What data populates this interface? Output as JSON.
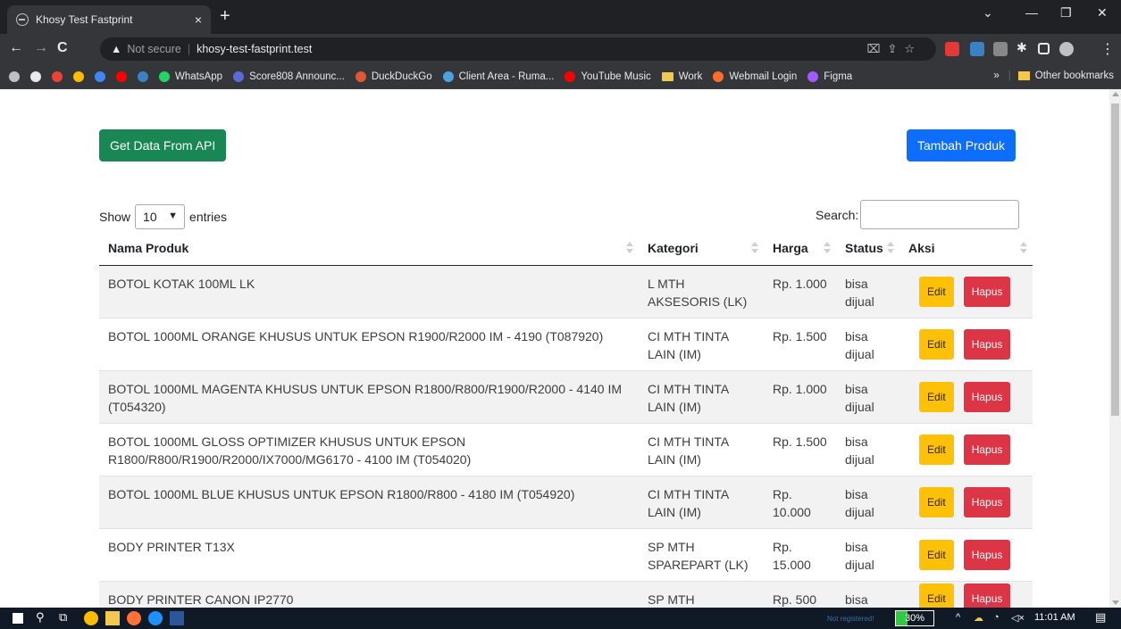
{
  "browser": {
    "tab_title": "Khosy Test Fastprint",
    "tab_close": "×",
    "new_tab": "+",
    "not_secure": "Not secure",
    "url": "khosy-test-fastprint.test",
    "bookmarks": [
      {
        "label": "WhatsApp",
        "color": "#25d366"
      },
      {
        "label": "Score808 Announc...",
        "color": "#5b6bd6"
      },
      {
        "label": "DuckDuckGo",
        "color": "#de5833"
      },
      {
        "label": "Client Area - Ruma...",
        "color": "#4aa3df"
      },
      {
        "label": "YouTube Music",
        "color": "#ff0000"
      },
      {
        "label": "Work",
        "color": "#f2c94c",
        "folder": true
      },
      {
        "label": "Webmail Login",
        "color": "#ff6c2c"
      },
      {
        "label": "Figma",
        "color": "#a259ff"
      }
    ],
    "overflow": "»",
    "other_bookmarks": "Other bookmarks"
  },
  "page": {
    "get_api_label": "Get Data From API",
    "tambah_label": "Tambah Produk",
    "show_label": "Show",
    "entries_value": "10",
    "entries_label": "entries",
    "search_label": "Search:",
    "search_value": "",
    "columns": [
      "Nama Produk",
      "Kategori",
      "Harga",
      "Status",
      "Aksi"
    ],
    "edit_label": "Edit",
    "hapus_label": "Hapus",
    "rows": [
      {
        "nama": "BOTOL KOTAK 100ML LK",
        "kategori": "L MTH AKSESORIS (LK)",
        "harga": "Rp. 1.000",
        "status": "bisa dijual"
      },
      {
        "nama": "BOTOL 1000ML ORANGE KHUSUS UNTUK EPSON R1900/R2000 IM - 4190 (T087920)",
        "kategori": "CI MTH TINTA LAIN (IM)",
        "harga": "Rp. 1.500",
        "status": "bisa dijual"
      },
      {
        "nama": "BOTOL 1000ML MAGENTA KHUSUS UNTUK EPSON R1800/R800/R1900/R2000 - 4140 IM (T054320)",
        "kategori": "CI MTH TINTA LAIN (IM)",
        "harga": "Rp. 1.000",
        "status": "bisa dijual"
      },
      {
        "nama": "BOTOL 1000ML GLOSS OPTIMIZER KHUSUS UNTUK EPSON R1800/R800/R1900/R2000/IX7000/MG6170 - 4100 IM (T054020)",
        "kategori": "CI MTH TINTA LAIN (IM)",
        "harga": "Rp. 1.500",
        "status": "bisa dijual"
      },
      {
        "nama": "BOTOL 1000ML BLUE KHUSUS UNTUK EPSON R1800/R800 - 4180 IM (T054920)",
        "kategori": "CI MTH TINTA LAIN (IM)",
        "harga": "Rp. 10.000",
        "status": "bisa dijual"
      },
      {
        "nama": "BODY PRINTER T13X",
        "kategori": "SP MTH SPAREPART (LK)",
        "harga": "Rp. 15.000",
        "status": "bisa dijual"
      },
      {
        "nama": "BODY PRINTER CANON IP2770",
        "kategori": "SP MTH",
        "harga": "Rp. 500",
        "status": "bisa"
      }
    ]
  },
  "taskbar": {
    "not_registered": "Not registered!",
    "battery": "30%",
    "battery_level": 0.3,
    "time": "11:01 AM"
  }
}
